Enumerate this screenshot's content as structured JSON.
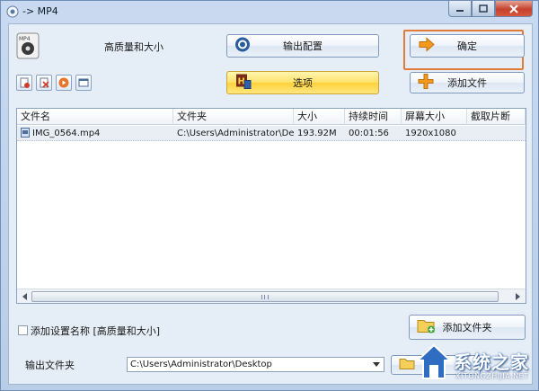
{
  "window": {
    "title": "-> MP4"
  },
  "top": {
    "quality_label": "高质量和大小",
    "output_config_label": "输出配置",
    "ok_label": "确定",
    "options_label": "选项",
    "add_file_label": "添加文件"
  },
  "table": {
    "columns": [
      "文件名",
      "文件夹",
      "大小",
      "持续时间",
      "屏幕大小",
      "截取片断"
    ],
    "rows": [
      {
        "name": "IMG_0564.mp4",
        "folder": "C:\\Users\\Administrator\\Des...",
        "size": "193.92M",
        "duration": "00:01:56",
        "resolution": "1920x1080",
        "clip": ""
      }
    ]
  },
  "bottom": {
    "add_setting_name_label": "添加设置名称 [高质量和大小]",
    "add_setting_name_checked": false,
    "add_folder_label": "添加文件夹",
    "output_folder_label": "输出文件夹",
    "output_folder_value": "C:\\Users\\Administrator\\Desktop",
    "browse_label": "浏"
  },
  "watermark": {
    "text": "系统之家",
    "url": "XITONGZHIJIA.NET"
  },
  "colors": {
    "highlight": "#e07b3a",
    "options_button": "#ffd23a",
    "window_frame": "#c9daf0"
  }
}
